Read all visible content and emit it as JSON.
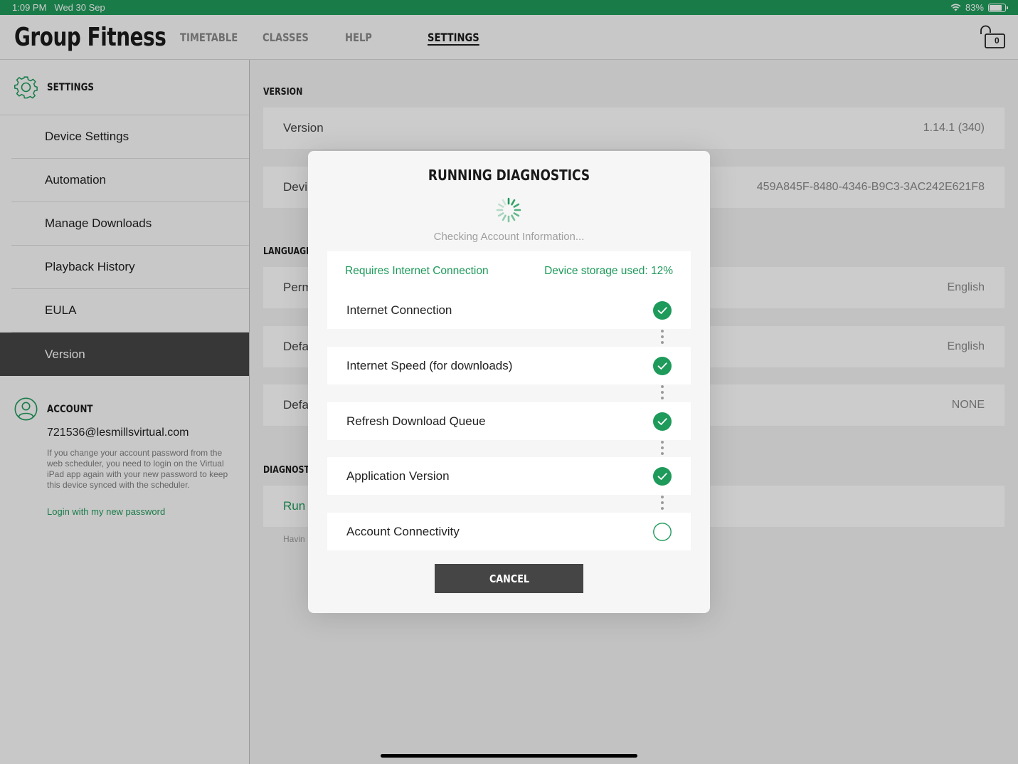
{
  "status_bar": {
    "time": "1:09 PM",
    "date": "Wed 30 Sep",
    "battery": "83%",
    "battery_level": 0.83
  },
  "app": {
    "title": "Group Fitness",
    "tabs": [
      {
        "label": "TIMETABLE"
      },
      {
        "label": "CLASSES"
      },
      {
        "label": "HELP"
      },
      {
        "label": "SETTINGS",
        "active": true
      }
    ],
    "lock_count": "0"
  },
  "sidebar": {
    "settings_title": "SETTINGS",
    "items": [
      {
        "label": "Device Settings"
      },
      {
        "label": "Automation"
      },
      {
        "label": "Manage Downloads"
      },
      {
        "label": "Playback History"
      },
      {
        "label": "EULA"
      },
      {
        "label": "Version",
        "active": true
      }
    ],
    "account": {
      "title": "ACCOUNT",
      "email": "721536@lesmillsvirtual.com",
      "note": "If you change your account password from the web scheduler, you need to login on the Virtual iPad app again with your new password to keep this device synced with the scheduler.",
      "login_link": "Login with my new password"
    }
  },
  "main": {
    "version_section": "VERSION",
    "version_label": "Version",
    "version_value": "1.14.1 (340)",
    "device_label": "Devi",
    "device_value": "459A845F-8480-4346-B9C3-3AC242E621F8",
    "language_section": "LANGUAGE",
    "perm_label": "Perm",
    "perm_value": "English",
    "default1_label": "Defa",
    "default1_value": "English",
    "default2_label": "Defa",
    "default2_value": "NONE",
    "diagnostics_section": "DIAGNOSTI",
    "run_label": "Run",
    "help_text": "Havin"
  },
  "modal": {
    "title": "RUNNING DIAGNOSTICS",
    "status": "Checking Account Information...",
    "requires_internet": "Requires Internet Connection",
    "storage": "Device storage used: 12%",
    "checks": [
      {
        "label": "Internet Connection",
        "state": "done"
      },
      {
        "label": "Internet Speed (for downloads)",
        "state": "done"
      },
      {
        "label": "Refresh Download Queue",
        "state": "done"
      },
      {
        "label": "Application Version",
        "state": "done"
      },
      {
        "label": "Account Connectivity",
        "state": "pending"
      }
    ],
    "cancel_label": "CANCEL"
  },
  "colors": {
    "accent": "#1e9a5a",
    "dark": "#454545"
  }
}
